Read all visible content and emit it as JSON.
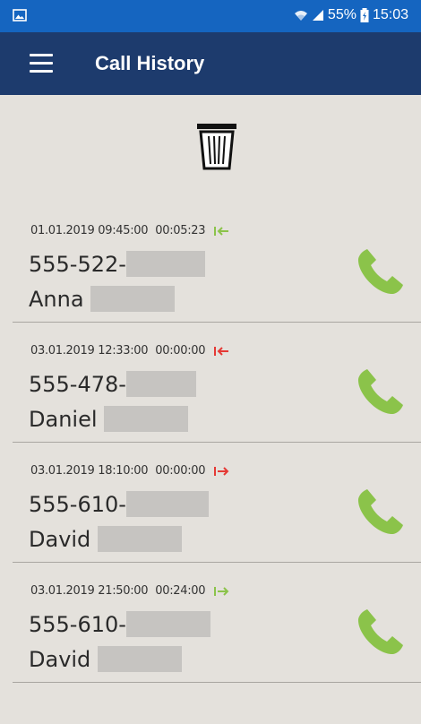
{
  "status_bar": {
    "battery": "55%",
    "time": "15:03",
    "icons": [
      "gallery-icon",
      "wifi-icon",
      "signal-icon",
      "battery-charging-icon"
    ]
  },
  "app_bar": {
    "title": "Call History",
    "menu_icon": "menu-icon"
  },
  "toolbar": {
    "delete_icon": "trash-icon"
  },
  "colors": {
    "status_bar": "#1565c0",
    "app_bar": "#1d3b6d",
    "background": "#e4e1dc",
    "phone_icon": "#8bc34a",
    "incoming_answered": "#8bc34a",
    "missed": "#e53935"
  },
  "calls": [
    {
      "datetime": "01.01.2019 09:45:00",
      "duration": "00:05:23",
      "direction": "incoming",
      "status": "answered",
      "number": "555-522-",
      "name": "Anna"
    },
    {
      "datetime": "03.01.2019 12:33:00",
      "duration": "00:00:00",
      "direction": "incoming",
      "status": "missed",
      "number": "555-478-",
      "name": "Daniel"
    },
    {
      "datetime": "03.01.2019 18:10:00",
      "duration": "00:00:00",
      "direction": "outgoing",
      "status": "missed",
      "number": "555-610-",
      "name": "David"
    },
    {
      "datetime": "03.01.2019 21:50:00",
      "duration": "00:24:00",
      "direction": "outgoing",
      "status": "answered",
      "number": "555-610-",
      "name": "David"
    }
  ]
}
